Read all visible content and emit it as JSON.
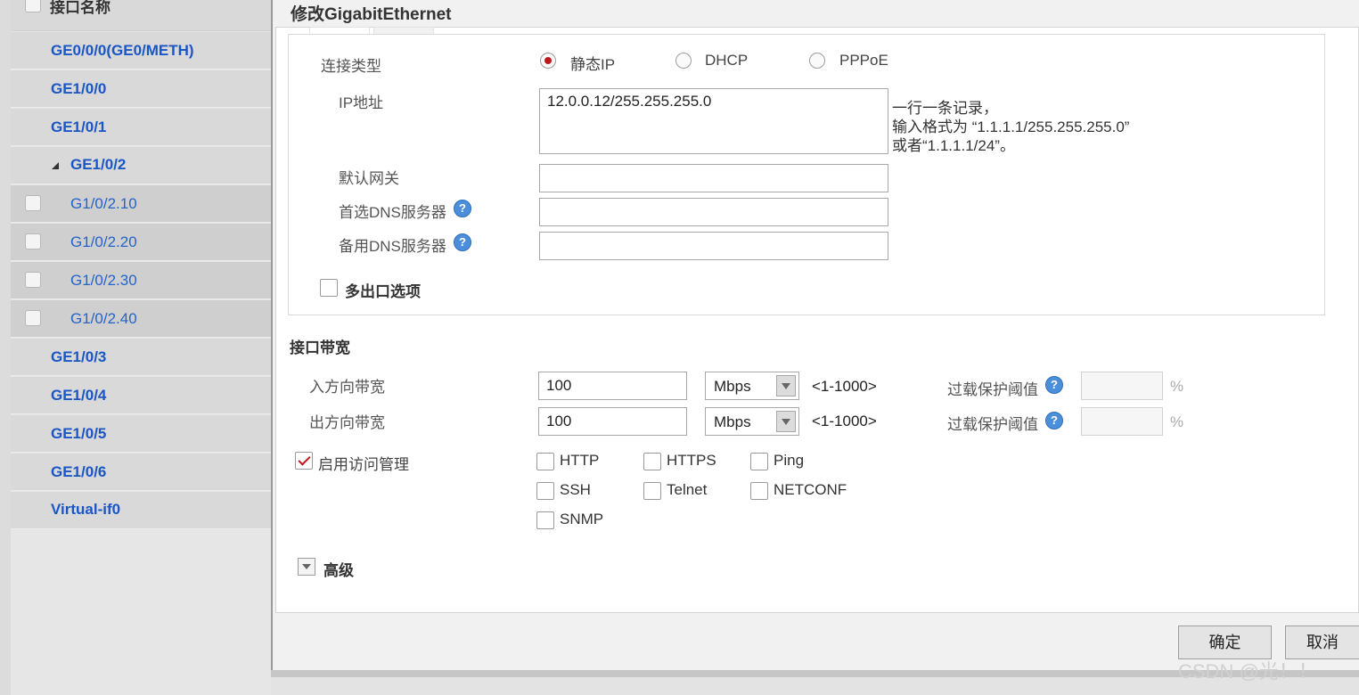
{
  "left_list": {
    "header": "接口名称",
    "items": [
      {
        "label": "GE0/0/0(GE0/METH)",
        "sub": false
      },
      {
        "label": "GE1/0/0",
        "sub": false
      },
      {
        "label": "GE1/0/1",
        "sub": false
      },
      {
        "label": "GE1/0/2",
        "sub": false,
        "expanded": true
      },
      {
        "label": "G1/0/2.10",
        "sub": true
      },
      {
        "label": "G1/0/2.20",
        "sub": true
      },
      {
        "label": "G1/0/2.30",
        "sub": true
      },
      {
        "label": "G1/0/2.40",
        "sub": true
      },
      {
        "label": "GE1/0/3",
        "sub": false
      },
      {
        "label": "GE1/0/4",
        "sub": false
      },
      {
        "label": "GE1/0/5",
        "sub": false
      },
      {
        "label": "GE1/0/6",
        "sub": false
      },
      {
        "label": "Virtual-if0",
        "sub": false
      }
    ]
  },
  "dialog": {
    "title": "修改GigabitEthernet",
    "connection_type": {
      "label": "连接类型",
      "options": [
        "静态IP",
        "DHCP",
        "PPPoE"
      ],
      "selected": "静态IP"
    },
    "ip_address": {
      "label": "IP地址",
      "value": "12.0.0.12/255.255.255.0",
      "hint_line1": "一行一条记录，",
      "hint_line2": "输入格式为 “1.1.1.1/255.255.255.0”",
      "hint_line3": "或者“1.1.1.1/24”。"
    },
    "gateway": {
      "label": "默认网关",
      "value": ""
    },
    "primary_dns": {
      "label": "首选DNS服务器",
      "value": ""
    },
    "secondary_dns": {
      "label": "备用DNS服务器",
      "value": ""
    },
    "multi_exit": {
      "label": "多出口选项",
      "checked": false
    },
    "bandwidth": {
      "section_title": "接口带宽",
      "inbound": {
        "label": "入方向带宽",
        "value": "100",
        "unit": "Mbps",
        "range": "<1-1000>",
        "overload_label": "过载保护阈值",
        "overload_value": "",
        "percent": "%"
      },
      "outbound": {
        "label": "出方向带宽",
        "value": "100",
        "unit": "Mbps",
        "range": "<1-1000>",
        "overload_label": "过载保护阈值",
        "overload_value": "",
        "percent": "%"
      }
    },
    "access_mgmt": {
      "label": "启用访问管理",
      "checked": true,
      "protocols": [
        "HTTP",
        "HTTPS",
        "Ping",
        "SSH",
        "Telnet",
        "NETCONF",
        "SNMP"
      ]
    },
    "advanced": {
      "label": "高级"
    },
    "ok_label": "确定",
    "cancel_label": "取消"
  },
  "watermark": "CSDN @光！！",
  "colors": {
    "accent_red": "#c0181f",
    "link_blue": "#1a56c4",
    "help_blue": "#4b8fdb"
  }
}
